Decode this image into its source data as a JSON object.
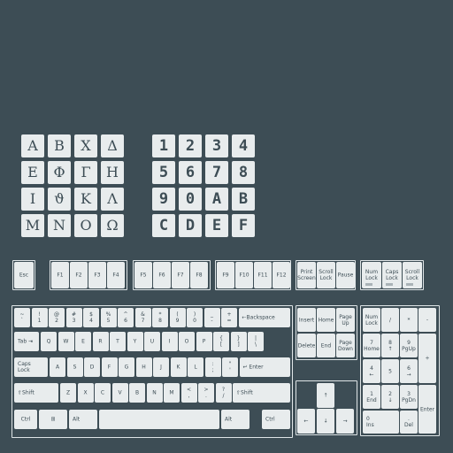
{
  "greek": [
    "Α",
    "Β",
    "Χ",
    "Δ",
    "Ε",
    "Φ",
    "Γ",
    "Η",
    "Ι",
    "ϑ",
    "Κ",
    "Λ",
    "Μ",
    "Ν",
    "Ο",
    "Ω"
  ],
  "hex": [
    "1",
    "2",
    "3",
    "4",
    "5",
    "6",
    "7",
    "8",
    "9",
    "0",
    "A",
    "B",
    "C",
    "D",
    "E",
    "F"
  ],
  "fkeys": {
    "esc": "Esc",
    "g1": [
      "F1",
      "F2",
      "F3",
      "F4"
    ],
    "g2": [
      "F5",
      "F6",
      "F7",
      "F8"
    ],
    "g3": [
      "F9",
      "F10",
      "F11",
      "F12"
    ],
    "sys": [
      "Print\nScreen",
      "Scroll\nLock",
      "Pause"
    ],
    "locks": [
      "Num\nLock",
      "Caps\nLock",
      "Scroll\nLock"
    ]
  },
  "main": {
    "row1": [
      "~\n`",
      "!\n1",
      "@\n2",
      "#\n3",
      "$\n4",
      "%\n5",
      "^\n6",
      "&\n7",
      "*\n8",
      "(\n9",
      ")\n0",
      "_\n-",
      "+\n="
    ],
    "backspace": "⇠Backspace",
    "tab": "Tab ⇥",
    "row2": [
      "Q",
      "W",
      "E",
      "R",
      "T",
      "Y",
      "U",
      "I",
      "O",
      "P",
      "{\n[",
      "}\n]",
      "|\n\\"
    ],
    "caps": "Caps\nLock",
    "row3": [
      "A",
      "S",
      "D",
      "F",
      "G",
      "H",
      "J",
      "K",
      "L",
      ":\n;",
      "\"\n'"
    ],
    "enter": "↵ Enter",
    "shift_l": "⇧Shift",
    "row4": [
      "Z",
      "X",
      "C",
      "V",
      "B",
      "N",
      "M",
      "<\n,",
      ">\n.",
      "?\n/"
    ],
    "shift_r": "⇧Shift",
    "ctrl": "Ctrl",
    "win": "⊞",
    "alt": "Alt",
    "space": "",
    "altgr": "Alt",
    "ctrl_r": "Ctrl"
  },
  "nav": [
    "Insert",
    "Home",
    "Page\nUp",
    "Delete",
    "End",
    "Page\nDown"
  ],
  "arrows": [
    "↑",
    "←",
    "↓",
    "→"
  ],
  "numpad": {
    "row1": [
      "Num\nLock",
      "/",
      "*",
      "-"
    ],
    "row2": [
      "7\nHome",
      "8\n↑",
      "9\nPgUp"
    ],
    "plus": "+",
    "row3": [
      "4\n←",
      "5",
      "6\n→"
    ],
    "row4": [
      "1\nEnd",
      "2\n↓",
      "3\nPgDn"
    ],
    "enter": "Enter",
    "zero": "0\nIns",
    "dot": ".\nDel"
  }
}
